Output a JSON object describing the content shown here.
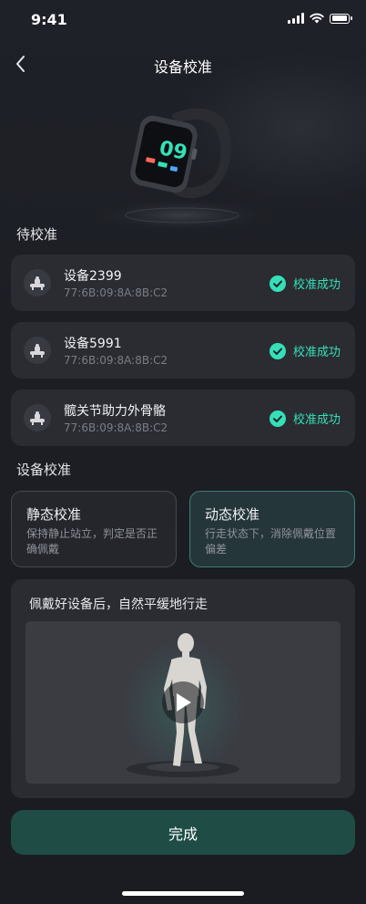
{
  "status_bar": {
    "time": "9:41"
  },
  "nav": {
    "title": "设备校准"
  },
  "watch": {
    "display_text": "09"
  },
  "pending": {
    "title": "待校准",
    "devices": [
      {
        "name": "设备2399",
        "mac": "77:6B:09:8A:8B:C2",
        "status": "校准成功"
      },
      {
        "name": "设备5991",
        "mac": "77:6B:09:8A:8B:C2",
        "status": "校准成功"
      },
      {
        "name": "髋关节助力外骨骼",
        "mac": "77:6B:09:8A:8B:C2",
        "status": "校准成功"
      }
    ]
  },
  "calibration": {
    "title": "设备校准",
    "modes": [
      {
        "title": "静态校准",
        "desc": "保持静止站立，判定是否正确佩戴",
        "selected": false
      },
      {
        "title": "动态校准",
        "desc": "行走状态下，消除佩戴位置偏差",
        "selected": true
      }
    ]
  },
  "instruction": {
    "text": "佩戴好设备后，自然平缓地行走"
  },
  "done_button": {
    "label": "完成"
  },
  "colors": {
    "accent": "#35e0b8",
    "primary_button": "#1f4d46",
    "card": "#2a2c32",
    "background": "#1c1e24"
  },
  "icons": {
    "back": "chevron-left-icon",
    "success": "check-circle-icon",
    "device": "exoskeleton-icon",
    "play": "play-icon"
  }
}
